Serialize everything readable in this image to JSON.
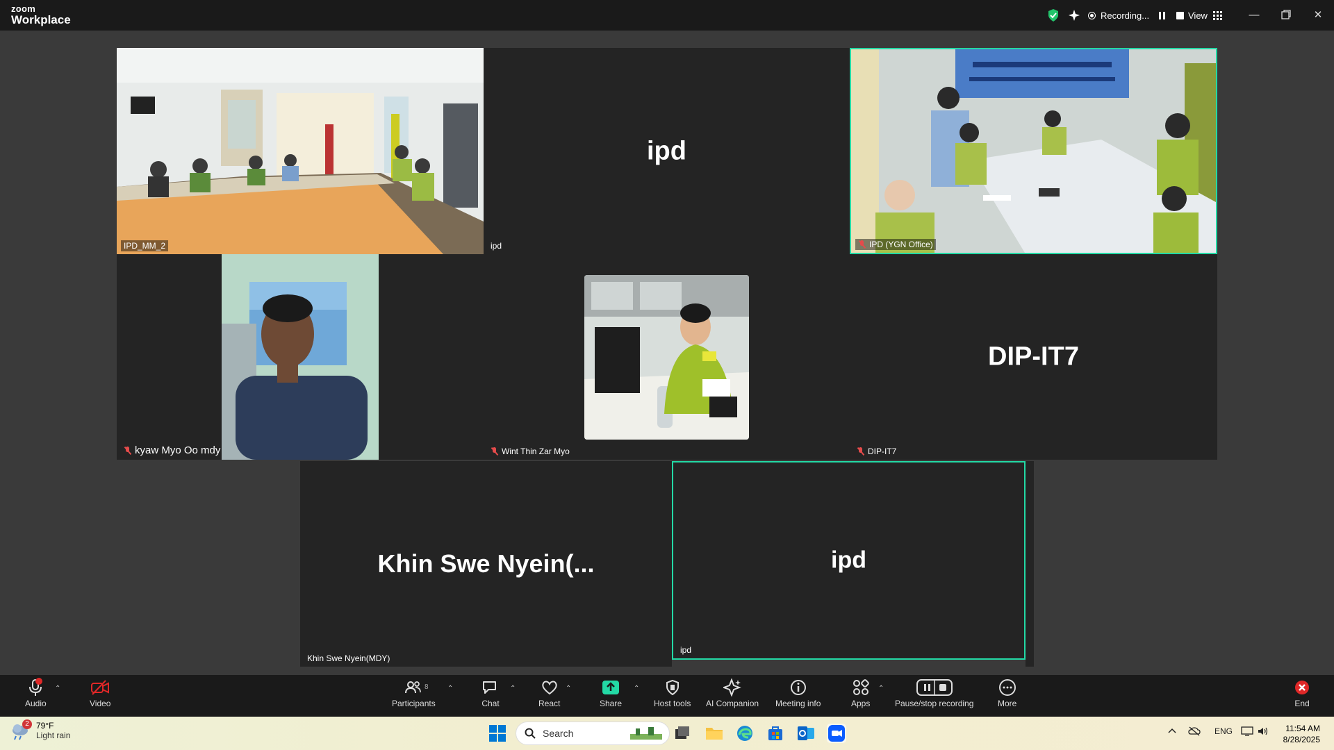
{
  "app": {
    "brand_top": "zoom",
    "brand_bottom": "Workplace"
  },
  "titlebar": {
    "recording_label": "Recording...",
    "view_label": "View"
  },
  "tiles": {
    "t1": {
      "name": "IPD_MM_2"
    },
    "t2": {
      "name": "ipd",
      "display": "ipd"
    },
    "t3": {
      "name": "IPD (YGN Office)"
    },
    "t4": {
      "name": "kyaw Myo Oo mdy"
    },
    "t5": {
      "name": "Wint Thin Zar Myo"
    },
    "t6": {
      "name": "DIP-IT7",
      "display": "DIP-IT7"
    },
    "t7": {
      "name": "Khin Swe Nyein(MDY)",
      "display": "Khin Swe Nyein(..."
    },
    "t8": {
      "name": "ipd",
      "display": "ipd"
    }
  },
  "toolbar": {
    "audio": "Audio",
    "video": "Video",
    "participants": "Participants",
    "participants_count": "8",
    "chat": "Chat",
    "react": "React",
    "share": "Share",
    "host_tools": "Host tools",
    "ai_companion": "AI Companion",
    "meeting_info": "Meeting info",
    "apps": "Apps",
    "pause_recording": "Pause/stop recording",
    "more": "More",
    "end": "End"
  },
  "taskbar": {
    "weather_badge": "2",
    "weather_temp": "79°F",
    "weather_desc": "Light rain",
    "search_placeholder": "Search",
    "lang": "ENG",
    "time": "11:54 AM",
    "date": "8/28/2025"
  },
  "colors": {
    "active_border": "#23d9a5",
    "share_green": "#23d9a5",
    "end_red": "#e02828",
    "stage_bg": "#3a3a3a"
  }
}
